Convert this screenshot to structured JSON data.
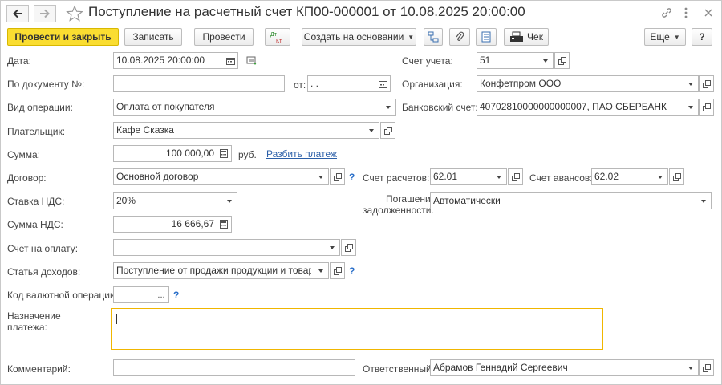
{
  "window": {
    "title": "Поступление на расчетный счет КП00-000001 от 10.08.2025 20:00:00"
  },
  "toolbar": {
    "post_close": "Провести и закрыть",
    "save": "Записать",
    "post": "Провести",
    "dt_kt": "Дт Кт",
    "create_based": "Создать на основании",
    "check": "Чек",
    "more": "Еще",
    "help": "?"
  },
  "form": {
    "date_label": "Дата:",
    "date_value": "10.08.2025 20:00:00",
    "doc_number_label": "По документу №:",
    "doc_number_value": "",
    "from_label": "от:",
    "from_value": " .  .",
    "operation_label": "Вид операции:",
    "operation_value": "Оплата от покупателя",
    "payer_label": "Плательщик:",
    "payer_value": "Кафе Сказка",
    "sum_label": "Сумма:",
    "sum_value": "100 000,00",
    "currency": "руб.",
    "split_link": "Разбить платеж",
    "contract_label": "Договор:",
    "contract_value": "Основной договор",
    "vat_rate_label": "Ставка НДС:",
    "vat_rate_value": "20%",
    "vat_sum_label": "Сумма НДС:",
    "vat_sum_value": "16 666,67",
    "invoice_label": "Счет на оплату:",
    "invoice_value": "",
    "income_item_label": "Статья доходов:",
    "income_item_value": "Поступление от продажи продукции и товаров, р",
    "currency_op_label": "Код валютной операции:",
    "currency_op_value": "",
    "purpose_label_1": "Назначение",
    "purpose_label_2": "платежа:",
    "purpose_value": "",
    "comment_label": "Комментарий:",
    "comment_value": "",
    "account_label": "Счет учета:",
    "account_value": "51",
    "org_label": "Организация:",
    "org_value": "Конфетпром ООО",
    "bank_account_label": "Банковский счет:",
    "bank_account_value": "40702810000000000007, ПАО СБЕРБАНК",
    "settle_account_label": "Счет расчетов:",
    "settle_account_value": "62.01",
    "advance_account_label": "Счет авансов:",
    "advance_account_value": "62.02",
    "debt_repay_label_1": "Погашение",
    "debt_repay_label_2": "задолженности:",
    "debt_repay_value": "Автоматически",
    "responsible_label": "Ответственный:",
    "responsible_value": "Абрамов Геннадий Сергеевич",
    "question": "?",
    "ellipsis": "..."
  },
  "colors": {
    "primary_button": "#fadd31",
    "focus_border": "#f0b600",
    "link": "#2b5fa8"
  }
}
